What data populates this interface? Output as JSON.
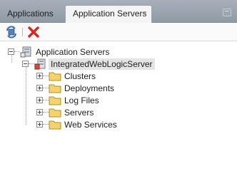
{
  "tabs": [
    {
      "label": "Applications",
      "active": false
    },
    {
      "label": "Application Servers",
      "active": true,
      "close_glyph": "×"
    }
  ],
  "toolbar": {
    "refresh_icon": "refresh-icon",
    "delete_icon": "delete-icon"
  },
  "tree": {
    "root": {
      "label": "Application Servers",
      "icon": "server-icon",
      "expanded": true
    },
    "server": {
      "label": "IntegratedWebLogicServer",
      "icon": "weblogic-server-icon",
      "expanded": true,
      "selected": true
    },
    "children": [
      {
        "label": "Clusters",
        "icon": "folder-icon"
      },
      {
        "label": "Deployments",
        "icon": "folder-icon"
      },
      {
        "label": "Log Files",
        "icon": "folder-icon"
      },
      {
        "label": "Servers",
        "icon": "folder-icon"
      },
      {
        "label": "Web Services",
        "icon": "folder-icon"
      }
    ]
  },
  "colors": {
    "tab_bar": "#98a3ae",
    "active_tab": "#f4f4f4",
    "delete_red": "#d9261c",
    "folder_yellow": "#f3d36b",
    "selection": "#e4e4e4"
  }
}
